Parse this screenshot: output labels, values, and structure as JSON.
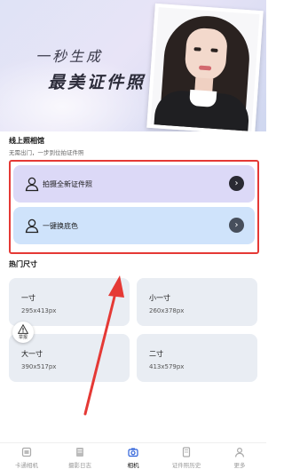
{
  "banner": {
    "line1": "一秒生成",
    "line2": "最美证件照"
  },
  "section": {
    "title": "线上照相馆",
    "subtitle": "无需出门，一步到位拍证件照"
  },
  "actions": [
    {
      "label": "拍摄全新证件照",
      "icon": "person-icon",
      "arrow": "›"
    },
    {
      "label": "一键换底色",
      "icon": "person-icon",
      "arrow": "›"
    }
  ],
  "hot_sizes": {
    "title": "热门尺寸",
    "items": [
      {
        "name": "一寸",
        "dimensions": "295x413px"
      },
      {
        "name": "小一寸",
        "dimensions": "260x378px"
      },
      {
        "name": "大一寸",
        "dimensions": "390x517px"
      },
      {
        "name": "二寸",
        "dimensions": "413x579px"
      }
    ]
  },
  "report": {
    "label": "举报",
    "icon": "warning-icon"
  },
  "tabs": [
    {
      "label": "卡通相机",
      "icon": "cartoon-camera-icon",
      "active": false
    },
    {
      "label": "摄影日志",
      "icon": "photo-log-icon",
      "active": false
    },
    {
      "label": "相机",
      "icon": "camera-icon",
      "active": true
    },
    {
      "label": "证件照历史",
      "icon": "id-history-icon",
      "active": false
    },
    {
      "label": "更多",
      "icon": "more-user-icon",
      "active": false
    }
  ],
  "colors": {
    "highlight": "#e53935",
    "card1": "#dcd9f7",
    "card2": "#cfe3fb",
    "size_card": "#e9edf3",
    "active_tab": "#111111",
    "inactive_tab": "#999999"
  }
}
